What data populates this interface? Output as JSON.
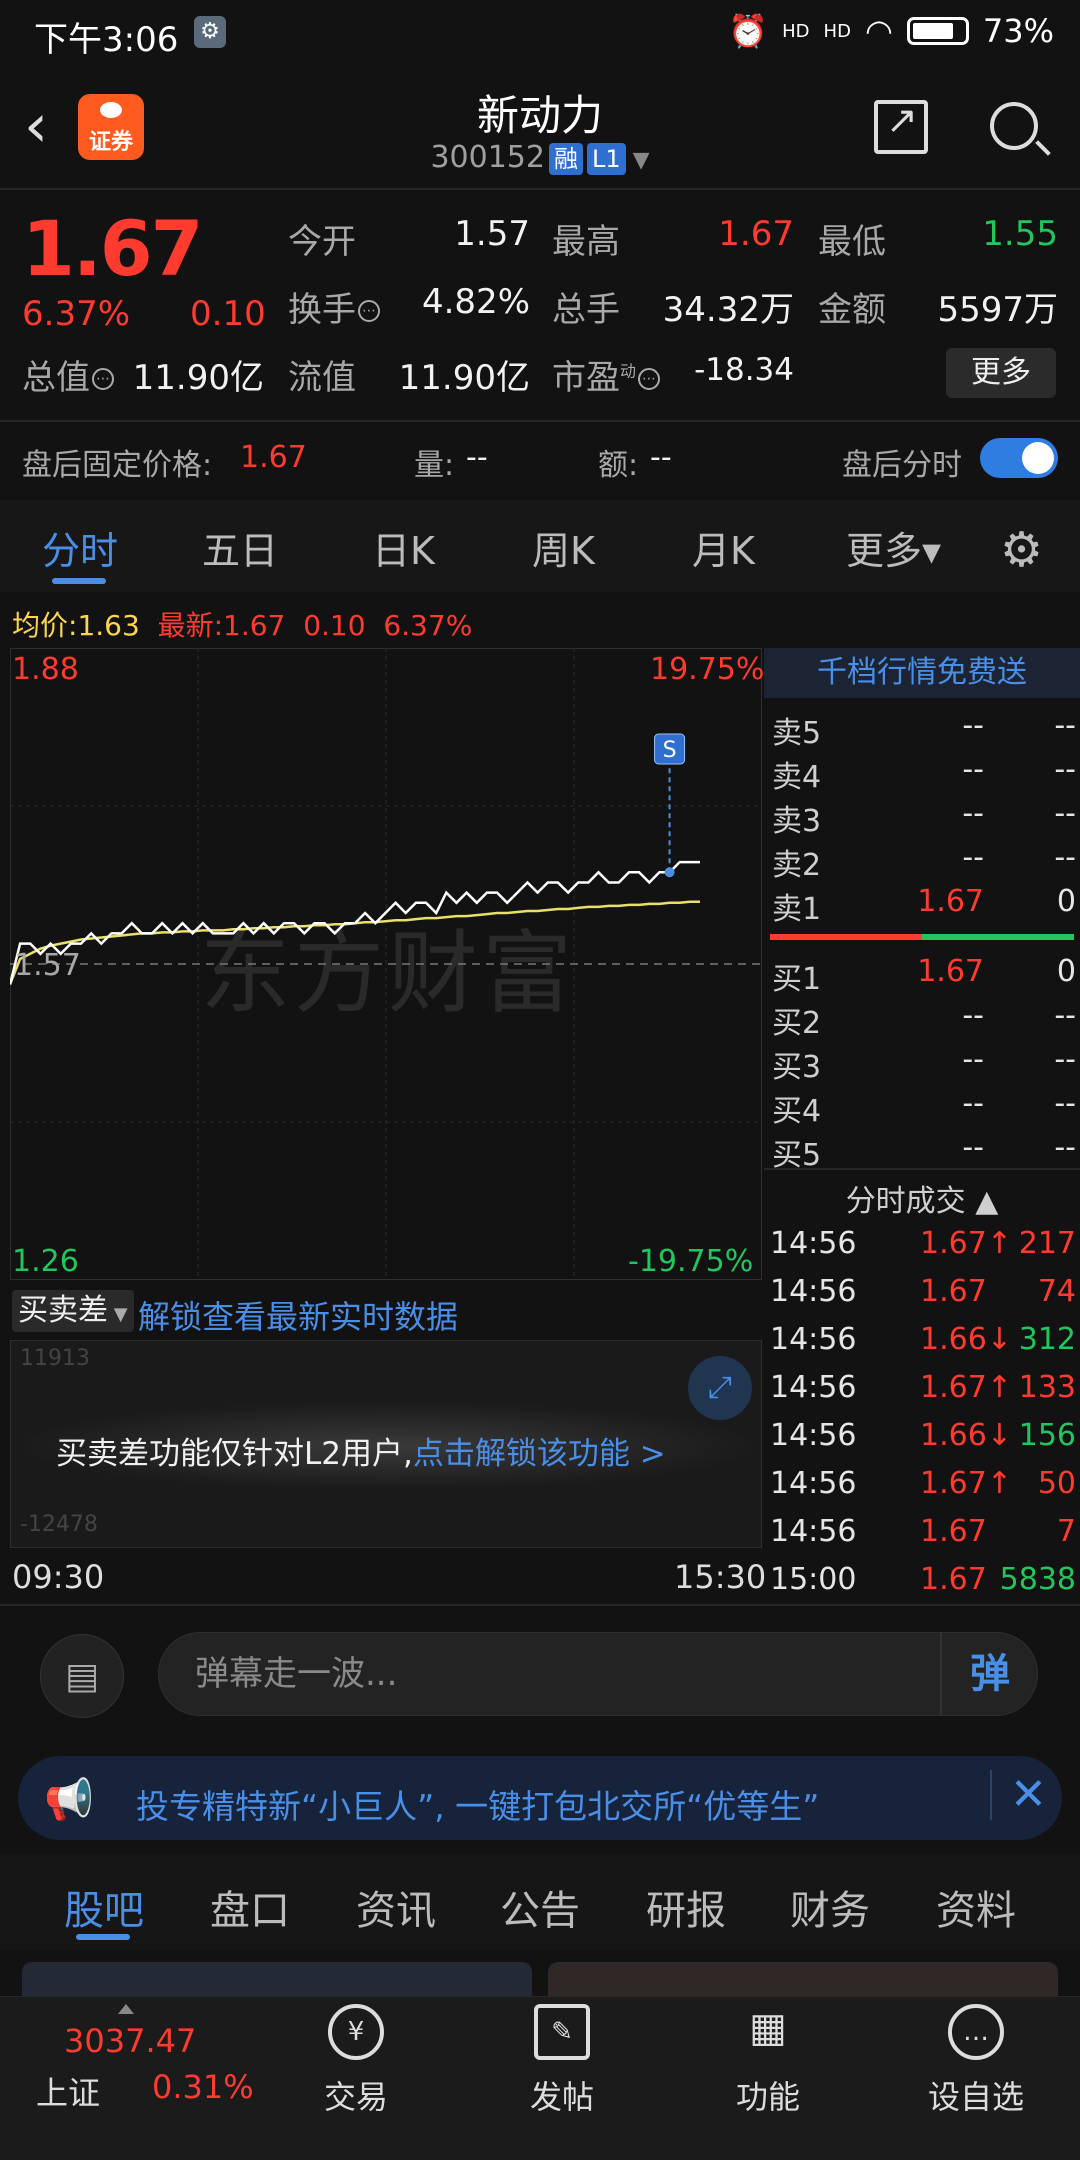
{
  "status_bar": {
    "time": "下午3:06",
    "signal1": "HD",
    "signal2": "HD",
    "battery": "73%"
  },
  "header": {
    "stock_name": "新动力",
    "stock_code": "300152",
    "tag1": "融",
    "tag2": "L1",
    "logo_text": "证券"
  },
  "quote": {
    "price": "1.67",
    "pct": "6.37%",
    "change": "0.10",
    "labels": {
      "open": "今开",
      "high": "最高",
      "low": "最低",
      "turnover": "换手",
      "volume": "总手",
      "amount": "金额",
      "total_mv": "总值",
      "float_mv": "流值",
      "pe": "市盈",
      "pe_sup": "动"
    },
    "values": {
      "open": "1.57",
      "high": "1.67",
      "low": "1.55",
      "turnover": "4.82%",
      "volume": "34.32万",
      "amount": "5597万",
      "total_mv": "11.90亿",
      "float_mv": "11.90亿",
      "pe": "-18.34"
    },
    "more_label": "更多"
  },
  "after_hours": {
    "label": "盘后固定价格:",
    "price": "1.67",
    "vol_label": "量:",
    "vol_value": "--",
    "amt_label": "额:",
    "amt_value": "--",
    "switch_label": "盘后分时"
  },
  "tabs": [
    "分时",
    "五日",
    "日K",
    "周K",
    "月K",
    "更多▾"
  ],
  "chart_info": {
    "avg_label": "均价:",
    "avg": "1.63",
    "latest_label": "最新:",
    "latest": "1.67",
    "change": "0.10",
    "pct": "6.37%"
  },
  "chart_data": {
    "type": "line",
    "y_labels": {
      "top_price": "1.88",
      "base_price": "1.57",
      "bottom_price": "1.26",
      "top_pct": "19.75%",
      "bottom_pct": "-19.75%"
    },
    "ylim": [
      1.26,
      1.88
    ],
    "base": 1.57,
    "x_start": "09:30",
    "x_end": "15:30",
    "signal_marker": "S",
    "series": [
      {
        "values": [
          1.55,
          1.59,
          1.59,
          1.58,
          1.59,
          1.58,
          1.59,
          1.59,
          1.6,
          1.59,
          1.6,
          1.6,
          1.61,
          1.6,
          1.6,
          1.61,
          1.6,
          1.61,
          1.6,
          1.61,
          1.6,
          1.6,
          1.6,
          1.61,
          1.6,
          1.61,
          1.6,
          1.61,
          1.61,
          1.6,
          1.61,
          1.61,
          1.6,
          1.61,
          1.61,
          1.62,
          1.61,
          1.62,
          1.63,
          1.62,
          1.63,
          1.63,
          1.62,
          1.64,
          1.63,
          1.64,
          1.63,
          1.64,
          1.64,
          1.63,
          1.64,
          1.65,
          1.64,
          1.65,
          1.65,
          1.64,
          1.65,
          1.65,
          1.66,
          1.65,
          1.65,
          1.66,
          1.66,
          1.65,
          1.66,
          1.66,
          1.67,
          1.67,
          1.67
        ]
      },
      {
        "values": [
          1.55,
          1.575,
          1.58,
          1.585,
          1.588,
          1.59,
          1.592,
          1.594,
          1.595,
          1.596,
          1.597,
          1.598,
          1.599,
          1.6,
          1.6,
          1.601,
          1.601,
          1.602,
          1.602,
          1.603,
          1.603,
          1.603,
          1.604,
          1.604,
          1.605,
          1.605,
          1.606,
          1.606,
          1.607,
          1.607,
          1.608,
          1.608,
          1.609,
          1.609,
          1.61,
          1.611,
          1.611,
          1.612,
          1.613,
          1.613,
          1.614,
          1.615,
          1.615,
          1.616,
          1.617,
          1.617,
          1.618,
          1.619,
          1.62,
          1.62,
          1.621,
          1.622,
          1.622,
          1.623,
          1.624,
          1.624,
          1.625,
          1.626,
          1.626,
          1.627,
          1.627,
          1.628,
          1.628,
          1.629,
          1.629,
          1.63,
          1.63,
          1.631,
          1.631
        ]
      }
    ]
  },
  "watermark": "东方财富",
  "order_book": {
    "header": "千档行情免费送",
    "asks": [
      {
        "label": "卖5",
        "price": "--",
        "vol": "--"
      },
      {
        "label": "卖4",
        "price": "--",
        "vol": "--"
      },
      {
        "label": "卖3",
        "price": "--",
        "vol": "--"
      },
      {
        "label": "卖2",
        "price": "--",
        "vol": "--"
      },
      {
        "label": "卖1",
        "price": "1.67",
        "vol": "0"
      }
    ],
    "bids": [
      {
        "label": "买1",
        "price": "1.67",
        "vol": "0"
      },
      {
        "label": "买2",
        "price": "--",
        "vol": "--"
      },
      {
        "label": "买3",
        "price": "--",
        "vol": "--"
      },
      {
        "label": "买4",
        "price": "--",
        "vol": "--"
      },
      {
        "label": "买5",
        "price": "--",
        "vol": "--"
      }
    ],
    "ask_bid_ratio": 0.5
  },
  "deals": {
    "title": "分时成交 ▲",
    "rows": [
      {
        "time": "14:56",
        "price": "1.67↑",
        "vol": "217",
        "dir": "up"
      },
      {
        "time": "14:56",
        "price": "1.67",
        "vol": "74",
        "dir": "flat"
      },
      {
        "time": "14:56",
        "price": "1.66↓",
        "vol": "312",
        "dir": "down"
      },
      {
        "time": "14:56",
        "price": "1.67↑",
        "vol": "133",
        "dir": "up"
      },
      {
        "time": "14:56",
        "price": "1.66↓",
        "vol": "156",
        "dir": "down"
      },
      {
        "time": "14:56",
        "price": "1.67↑",
        "vol": "50",
        "dir": "up"
      },
      {
        "time": "14:56",
        "price": "1.67",
        "vol": "7",
        "dir": "flat"
      },
      {
        "time": "15:00",
        "price": "1.67",
        "vol": "5838",
        "dir": "down"
      }
    ]
  },
  "mmc": {
    "dropdown": "买卖差",
    "unlock_link": "解锁查看最新实时数据",
    "message": "买卖差功能仅针对L2用户,",
    "message_link": "点击解锁该功能 >",
    "top_value": "11913",
    "bottom_value": "-12478"
  },
  "comment": {
    "placeholder": "弹幕走一波...",
    "send": "弹"
  },
  "ad": {
    "text": "投专精特新“小巨人”, 一键打包北交所“优等生”"
  },
  "lower_tabs": [
    "股吧",
    "盘口",
    "资讯",
    "公告",
    "研报",
    "财务",
    "资料"
  ],
  "bottom_nav": {
    "index_value": "3037.47",
    "index_name": "上证",
    "index_pct": "0.31%",
    "items": [
      {
        "label": "交易",
        "icon": "¥"
      },
      {
        "label": "发帖",
        "icon": "✎"
      },
      {
        "label": "功能",
        "icon": "▦"
      },
      {
        "label": "设自选",
        "icon": "…"
      }
    ]
  },
  "colors": {
    "up": "#ff3b30",
    "down": "#22c55e",
    "accent": "#4a8fe7",
    "avg_line": "#e8e06a",
    "price_line": "#ffffff"
  }
}
